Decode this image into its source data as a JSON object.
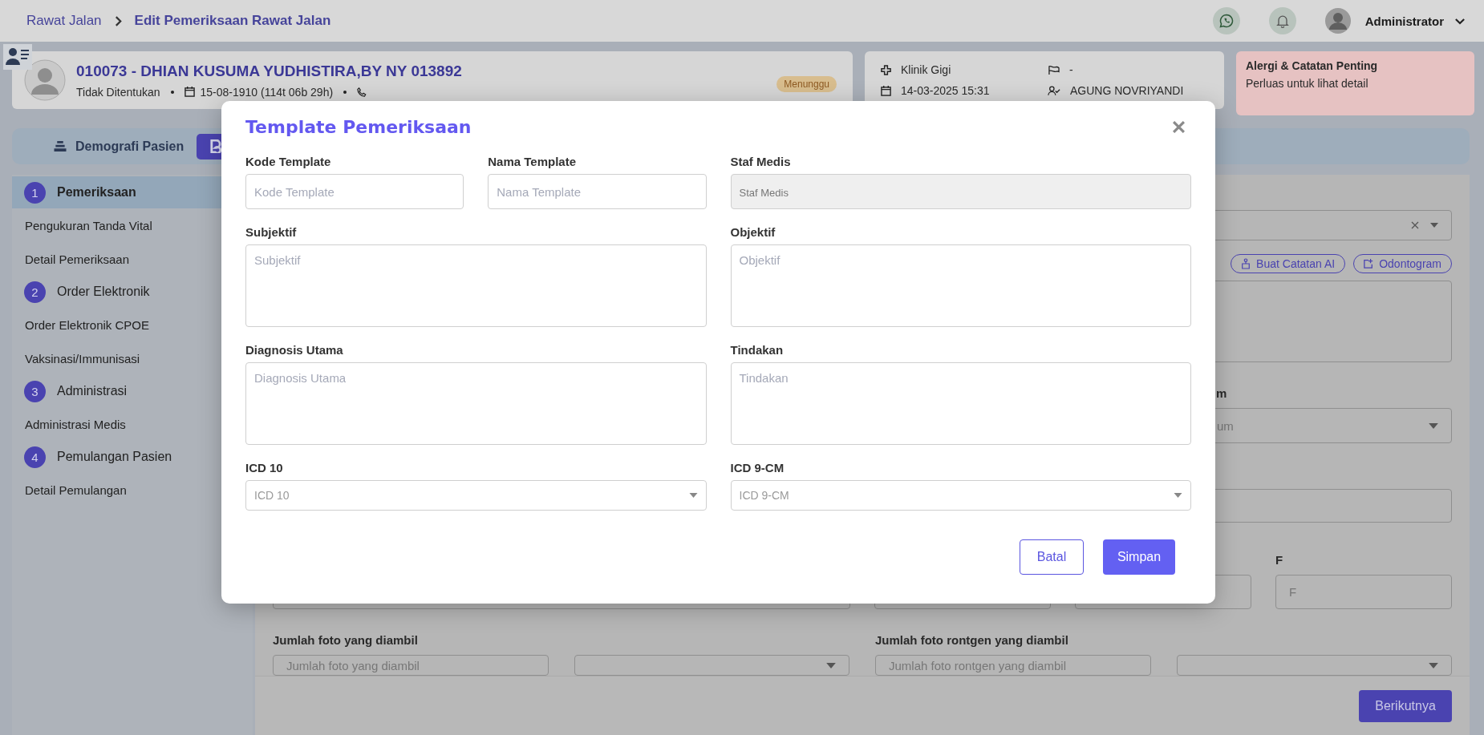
{
  "header": {
    "breadcrumb": [
      "Rawat Jalan",
      "Edit Pemeriksaan Rawat Jalan"
    ],
    "user": "Administrator"
  },
  "patient": {
    "name": "010073 - DHIAN KUSUMA YUDHISTIRA,BY NY 013892",
    "gender": "Tidak Ditentukan",
    "birth": "15-08-1910 (114t 06b 29h)",
    "status": "Menunggu"
  },
  "visit": {
    "clinic": "Klinik Gigi",
    "datetime": "14-03-2025 15:31",
    "room": "-",
    "doctor": "AGUNG NOVRIYANDI"
  },
  "alert": {
    "title": "Alergi & Catatan Penting",
    "hint": "Perluas untuk lihat detail"
  },
  "tabs": [
    {
      "label": "Demografi Pasien",
      "selected": false
    },
    {
      "selected": true
    }
  ],
  "steps": [
    {
      "number": "1",
      "label": "Pemeriksaan",
      "selected": true,
      "children": [
        {
          "label": "Pengukuran Tanda Vital",
          "selected": false
        },
        {
          "label": "Detail Pemeriksaan",
          "selected": false
        }
      ]
    },
    {
      "number": "2",
      "label": "Order Elektronik",
      "selected": false,
      "children": [
        {
          "label": "Order Elektronik CPOE",
          "selected": false
        },
        {
          "label": "Vaksinasi/Immunisasi",
          "selected": false
        }
      ]
    },
    {
      "number": "3",
      "label": "Administrasi",
      "selected": false,
      "children": [
        {
          "label": "Administrasi Medis",
          "selected": false
        }
      ]
    },
    {
      "number": "4",
      "label": "Pemulangan Pasien",
      "selected": false,
      "children": [
        {
          "label": "Detail Pemulangan",
          "selected": false
        }
      ]
    }
  ],
  "form": {
    "ai_button": "Buat Catatan AI",
    "odontogram_button": "Odontogram",
    "partial_label": "m",
    "partial_placeholder": "um",
    "f_label": "F",
    "f_placeholder": "F",
    "photo_label": "Jumlah foto yang diambil",
    "photo_placeholder": "Jumlah foto yang diambil",
    "xray_label": "Jumlah foto rontgen yang diambil",
    "xray_placeholder": "Jumlah foto rontgen yang diambil"
  },
  "footer": {
    "next_button": "Berikutnya"
  },
  "modal": {
    "title": "Template Pemeriksaan",
    "fields": [
      {
        "kind": "input",
        "label": "Kode Template",
        "placeholder": "Kode Template",
        "disabled": false
      },
      {
        "kind": "input",
        "label": "Nama Template",
        "placeholder": "Nama Template",
        "disabled": false
      },
      {
        "kind": "input",
        "label": "Staf Medis",
        "placeholder": "Staf Medis",
        "disabled": true
      },
      {
        "kind": "textarea",
        "label": "Subjektif",
        "placeholder": "Subjektif"
      },
      {
        "kind": "textarea",
        "label": "Objektif",
        "placeholder": "Objektif"
      },
      {
        "kind": "textarea",
        "label": "Diagnosis Utama",
        "placeholder": "Diagnosis Utama"
      },
      {
        "kind": "textarea",
        "label": "Tindakan",
        "placeholder": "Tindakan"
      },
      {
        "kind": "select",
        "label": "ICD 10",
        "placeholder": "ICD 10"
      },
      {
        "kind": "select",
        "label": "ICD 9-CM",
        "placeholder": "ICD 9-CM"
      }
    ],
    "buttons": [
      {
        "label": "Batal",
        "kind": "secondary"
      },
      {
        "label": "Simpan",
        "kind": "primary"
      }
    ]
  }
}
